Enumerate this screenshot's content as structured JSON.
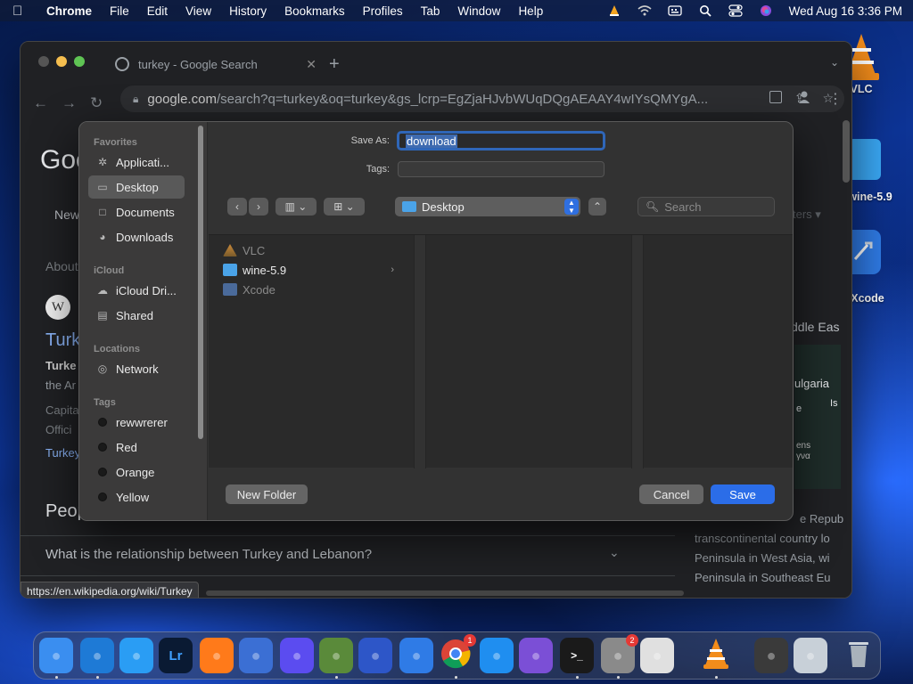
{
  "menubar": {
    "app_name": "Chrome",
    "menus": [
      "File",
      "Edit",
      "View",
      "History",
      "Bookmarks",
      "Profiles",
      "Tab",
      "Window",
      "Help"
    ],
    "datetime": "Wed Aug 16  3:36 PM"
  },
  "desktop": {
    "icons": [
      {
        "label": "VLC",
        "icon": "vlc-icon"
      },
      {
        "label": "wine-5.9",
        "icon": "folder-icon"
      },
      {
        "label": "Xcode",
        "icon": "xcode-icon"
      }
    ]
  },
  "browser": {
    "tab_title": "turkey - Google Search",
    "url_host": "google.com",
    "url_path": "/search?q=turkey&oq=turkey&gs_lcrp=EgZjaHJvbWUqDQgAEAAY4wIYsQMYgA...",
    "status_url": "https://en.wikipedia.org/wiki/Turkey",
    "page": {
      "logo_partial": "Goo",
      "news_partial": "New",
      "filters_partial": "ters",
      "about_partial": "About",
      "wiki_initial": "W",
      "result_title_partial": "Turk",
      "result_snippet_1": "Turke",
      "result_snippet_2": "the Ar",
      "result_capital": "Capita",
      "result_official": "Offici",
      "result_turkey": "Turkey",
      "people_partial": "Peop",
      "right_1": "ddle Eas",
      "right_2": "ulgaria",
      "right_3": "e",
      "right_4": "Is",
      "right_5": "ens",
      "right_6": "γνα",
      "right_text_1": "e Repub",
      "right_text_2": "transcontinental country lo",
      "right_text_3": "Peninsula in West Asia, wi",
      "right_text_4": "Peninsula in Southeast Eu",
      "question": "What is the relationship between Turkey and Lebanon?"
    }
  },
  "dialog": {
    "save_as_label": "Save As:",
    "save_as_value": "download",
    "tags_label": "Tags:",
    "location": "Desktop",
    "search_placeholder": "Search",
    "sidebar": {
      "favorites_header": "Favorites",
      "favorites": [
        {
          "label": "Applicati...",
          "icon": "applications-icon"
        },
        {
          "label": "Desktop",
          "icon": "desktop-icon"
        },
        {
          "label": "Documents",
          "icon": "documents-icon"
        },
        {
          "label": "Downloads",
          "icon": "downloads-icon"
        }
      ],
      "icloud_header": "iCloud",
      "icloud": [
        {
          "label": "iCloud Dri...",
          "icon": "cloud-icon"
        },
        {
          "label": "Shared",
          "icon": "shared-folder-icon"
        }
      ],
      "locations_header": "Locations",
      "locations": [
        {
          "label": "Network",
          "icon": "network-icon"
        }
      ],
      "tags_header": "Tags",
      "tags": [
        {
          "label": "rewwrerer",
          "color": "#1a1a1a"
        },
        {
          "label": "Red",
          "color": "#1a1a1a"
        },
        {
          "label": "Orange",
          "color": "#1a1a1a"
        },
        {
          "label": "Yellow",
          "color": "#1a1a1a"
        }
      ]
    },
    "files": [
      {
        "name": "VLC",
        "dimmed": true,
        "icon": "vlc-icon"
      },
      {
        "name": "wine-5.9",
        "dimmed": false,
        "icon": "folder-icon",
        "has_children": true
      },
      {
        "name": "Xcode",
        "dimmed": true,
        "icon": "xcode-icon"
      }
    ],
    "new_folder_label": "New Folder",
    "cancel_label": "Cancel",
    "save_label": "Save"
  },
  "dock": {
    "apps": [
      {
        "name": "Finder",
        "icon": "finder-icon",
        "color": "#3a8ef0"
      },
      {
        "name": "Visual Studio Code",
        "icon": "vscode-icon",
        "color": "#1e7ad6"
      },
      {
        "name": "Safari",
        "icon": "safari-icon",
        "color": "#2a9df4"
      },
      {
        "name": "Lightroom",
        "icon": "lightroom-icon",
        "label": "Lr",
        "color": "#0a1a33"
      },
      {
        "name": "Firefox",
        "icon": "firefox-icon",
        "color": "#ff7a1a"
      },
      {
        "name": "Xcode",
        "icon": "xcode-icon",
        "color": "#3b6fd4"
      },
      {
        "name": "Firefox Nightly",
        "icon": "firefox-nightly-icon",
        "color": "#5b4cf0"
      },
      {
        "name": "Minecraft",
        "icon": "minecraft-icon",
        "color": "#5a8a3a"
      },
      {
        "name": "Screens",
        "icon": "screens-icon",
        "color": "#2d56c8"
      },
      {
        "name": "Xcode",
        "icon": "xcode-icon",
        "color": "#2f7be6"
      },
      {
        "name": "Chrome",
        "icon": "chrome-icon",
        "color": "#e8e8e8",
        "badge": "1"
      },
      {
        "name": "App Store",
        "icon": "app-store-icon",
        "color": "#1f8ef0"
      },
      {
        "name": "GitHub Desktop",
        "icon": "github-icon",
        "color": "#7b4fd6"
      },
      {
        "name": "Terminal",
        "icon": "terminal-icon",
        "color": "#1a1a1a"
      },
      {
        "name": "System Settings",
        "icon": "settings-icon",
        "color": "#8a8a8a",
        "badge": "2"
      },
      {
        "name": "Launchpad",
        "icon": "launchpad-icon",
        "color": "#e0e0e0"
      },
      {
        "name": "VLC",
        "icon": "vlc-icon",
        "color": "#f28c1b"
      },
      {
        "name": "Screenshot",
        "icon": "screenshot-icon",
        "color": "#3a3a3a"
      },
      {
        "name": "Preview",
        "icon": "preview-icon",
        "color": "#c8d0d8"
      },
      {
        "name": "Trash",
        "icon": "trash-icon",
        "color": "#9aa3ad"
      }
    ]
  }
}
